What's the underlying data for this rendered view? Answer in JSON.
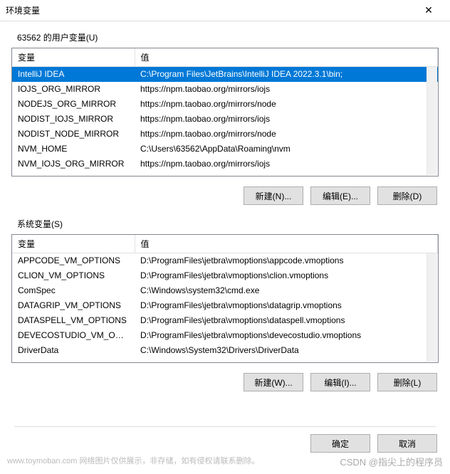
{
  "window": {
    "title": "环境变量",
    "close": "✕"
  },
  "user_section": {
    "label": "63562 的用户变量(U)",
    "header_var": "变量",
    "header_val": "值",
    "rows": [
      {
        "name": "IntelliJ IDEA",
        "value": "C:\\Program Files\\JetBrains\\IntelliJ IDEA 2022.3.1\\bin;",
        "selected": true
      },
      {
        "name": "IOJS_ORG_MIRROR",
        "value": "https://npm.taobao.org/mirrors/iojs"
      },
      {
        "name": "NODEJS_ORG_MIRROR",
        "value": "https://npm.taobao.org/mirrors/node"
      },
      {
        "name": "NODIST_IOJS_MIRROR",
        "value": "https://npm.taobao.org/mirrors/iojs"
      },
      {
        "name": "NODIST_NODE_MIRROR",
        "value": "https://npm.taobao.org/mirrors/node"
      },
      {
        "name": "NVM_HOME",
        "value": "C:\\Users\\63562\\AppData\\Roaming\\nvm"
      },
      {
        "name": "NVM_IOJS_ORG_MIRROR",
        "value": "https://npm.taobao.org/mirrors/iojs"
      }
    ],
    "btn_new": "新建(N)...",
    "btn_edit": "编辑(E)...",
    "btn_delete": "删除(D)"
  },
  "system_section": {
    "label": "系统变量(S)",
    "header_var": "变量",
    "header_val": "值",
    "rows": [
      {
        "name": "APPCODE_VM_OPTIONS",
        "value": "D:\\ProgramFiles\\jetbra\\vmoptions\\appcode.vmoptions"
      },
      {
        "name": "CLION_VM_OPTIONS",
        "value": "D:\\ProgramFiles\\jetbra\\vmoptions\\clion.vmoptions"
      },
      {
        "name": "ComSpec",
        "value": "C:\\Windows\\system32\\cmd.exe"
      },
      {
        "name": "DATAGRIP_VM_OPTIONS",
        "value": "D:\\ProgramFiles\\jetbra\\vmoptions\\datagrip.vmoptions"
      },
      {
        "name": "DATASPELL_VM_OPTIONS",
        "value": "D:\\ProgramFiles\\jetbra\\vmoptions\\dataspell.vmoptions"
      },
      {
        "name": "DEVECOSTUDIO_VM_OPT...",
        "value": "D:\\ProgramFiles\\jetbra\\vmoptions\\devecostudio.vmoptions"
      },
      {
        "name": "DriverData",
        "value": "C:\\Windows\\System32\\Drivers\\DriverData"
      }
    ],
    "btn_new": "新建(W)...",
    "btn_edit": "编辑(I)...",
    "btn_delete": "删除(L)"
  },
  "dialog": {
    "ok": "确定",
    "cancel": "取消"
  },
  "watermark": {
    "left": "www.toymoban.com 网络图片仅供展示，非存储，如有侵权请联系删除。",
    "right": "CSDN @指尖上的程序员"
  }
}
